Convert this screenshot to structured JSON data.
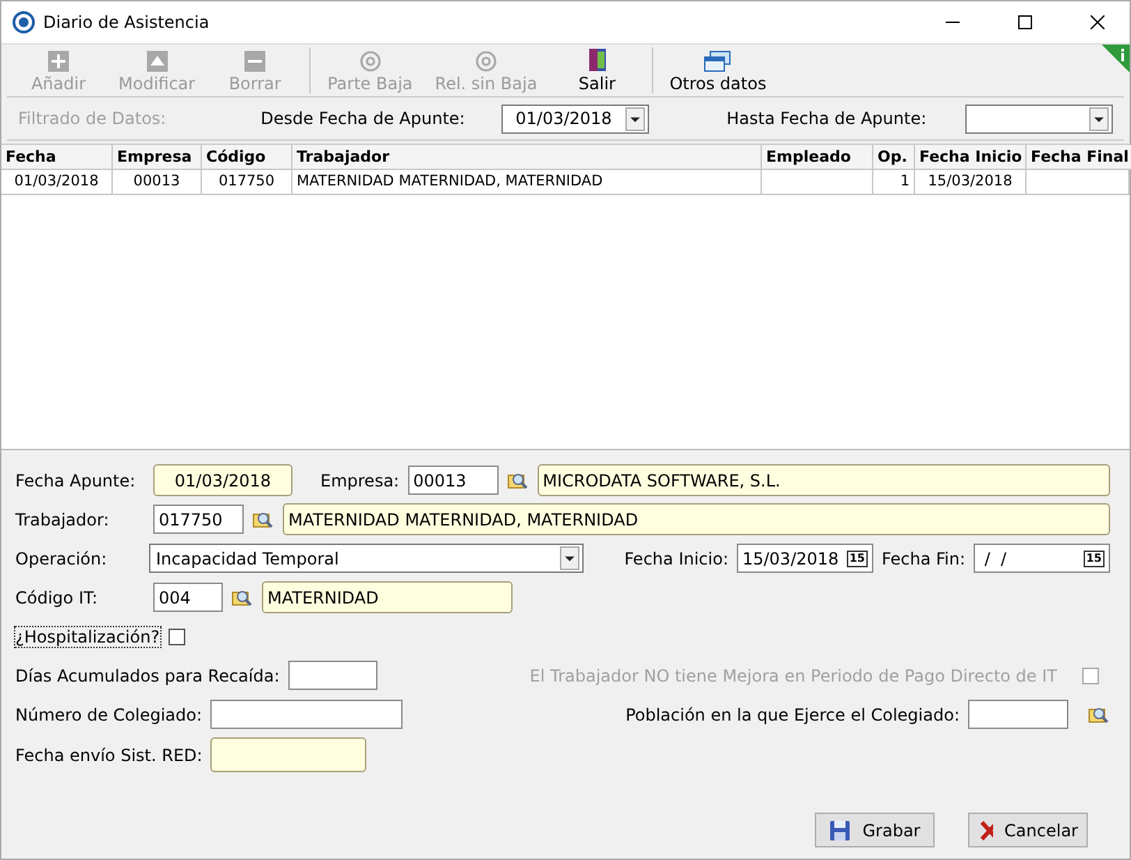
{
  "window": {
    "title": "Diario de Asistencia"
  },
  "toolbar": [
    {
      "label": "Añadir",
      "kind": "plus",
      "disabled": true,
      "separator_before": false
    },
    {
      "label": "Modificar",
      "kind": "triangle",
      "disabled": true,
      "separator_before": false
    },
    {
      "label": "Borrar",
      "kind": "minus",
      "disabled": true,
      "separator_before": false
    },
    {
      "label": "Parte Baja",
      "kind": "at",
      "disabled": true,
      "separator_before": true
    },
    {
      "label": "Rel. sin Baja",
      "kind": "at",
      "disabled": true,
      "separator_before": false
    },
    {
      "label": "Salir",
      "kind": "door",
      "disabled": false,
      "separator_before": false
    },
    {
      "label": "Otros datos",
      "kind": "windows",
      "disabled": false,
      "separator_before": true
    }
  ],
  "filter": {
    "title": "Filtrado de Datos:",
    "from_label": "Desde Fecha de Apunte:",
    "from_value": "01/03/2018",
    "to_label": "Hasta Fecha de Apunte:"
  },
  "table": {
    "columns": [
      "Fecha",
      "Empresa",
      "Código",
      "Trabajador",
      "Empleado",
      "Op.",
      "Fecha Inicio",
      "Fecha Final"
    ],
    "rows": [
      [
        "01/03/2018",
        "00013",
        "017750",
        "MATERNIDAD MATERNIDAD, MATERNIDAD",
        "",
        "1",
        "15/03/2018",
        ""
      ]
    ]
  },
  "form": {
    "fecha_apunte": {
      "label": "Fecha Apunte:",
      "value": "01/03/2018"
    },
    "empresa": {
      "label": "Empresa:",
      "code": "00013",
      "name": "MICRODATA SOFTWARE, S.L."
    },
    "trabajador": {
      "label": "Trabajador:",
      "code": "017750",
      "name": "MATERNIDAD MATERNIDAD, MATERNIDAD"
    },
    "operacion": {
      "label": "Operación:",
      "value": "Incapacidad Temporal"
    },
    "fecha_inicio": {
      "label": "Fecha Inicio:",
      "value": "15/03/2018",
      "picker_glyph": "15"
    },
    "fecha_fin": {
      "label": "Fecha Fin:",
      "value": " /  /",
      "picker_glyph": "15"
    },
    "codigo_it": {
      "label": "Código IT:",
      "code": "004",
      "name": "MATERNIDAD"
    },
    "hospitalizacion": {
      "label": "¿Hospitalización?",
      "checked": false
    },
    "dias": {
      "label": "Días Acumulados para Recaída:"
    },
    "mejora": {
      "label": "El Trabajador NO tiene Mejora en Periodo de Pago Directo de IT",
      "checked": false,
      "disabled": true
    },
    "colegiado": {
      "label": "Número de Colegiado:"
    },
    "poblacion": {
      "label": "Población en la que Ejerce el Colegiado:"
    },
    "envio": {
      "label": "Fecha envío Sist. RED:"
    }
  },
  "buttons": [
    {
      "label": "Grabar",
      "kind": "save"
    },
    {
      "label": "Cancelar",
      "kind": "cancel"
    }
  ]
}
